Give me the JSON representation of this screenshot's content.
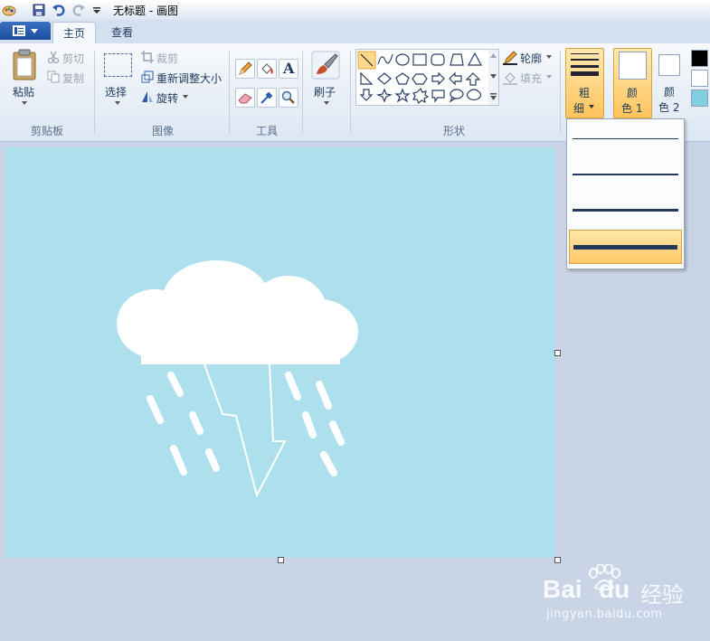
{
  "titlebar": {
    "title": "无标题 - 画图",
    "quick_access": [
      "paint-app-icon",
      "save-icon",
      "undo-icon",
      "redo-icon",
      "customize-arrow-icon"
    ]
  },
  "tabs": {
    "home": "主页",
    "view": "查看"
  },
  "clipboard": {
    "paste": "粘贴",
    "cut": "剪切",
    "copy": "复制",
    "group": "剪贴板"
  },
  "image": {
    "select": "选择",
    "crop": "裁剪",
    "resize": "重新调整大小",
    "rotate": "旋转",
    "group": "图像"
  },
  "tools": {
    "group": "工具",
    "items": [
      "pencil-icon",
      "fill-bucket-icon",
      "text-icon",
      "eraser-icon",
      "color-picker-icon",
      "magnifier-icon"
    ],
    "text_glyph": "A"
  },
  "brushes": {
    "label": "刷子"
  },
  "shapes": {
    "group": "形状",
    "outline": "轮廓",
    "fill": "填充"
  },
  "size": {
    "label_line1": "粗",
    "label_line2": "细"
  },
  "colors": {
    "color1_line1": "颜",
    "color1_line2": "色 1",
    "color2_line1": "颜",
    "color2_line2": "色 2",
    "color1_value": "#ffffff",
    "color2_value": "#ffffff",
    "palette": [
      "#000000",
      "#ffffff",
      "#7fcfe0"
    ]
  },
  "canvas": {
    "background": "#ade0ec",
    "elements": [
      "cloud",
      "rain-drops",
      "lightning-bolt"
    ]
  },
  "size_dropdown": {
    "options": [
      "1px",
      "3px",
      "5px",
      "8px"
    ],
    "selected_index": 3
  },
  "watermark": {
    "brand": "Bai",
    "brand2": "du",
    "product": "经验",
    "url": "jingyan.baidu.com"
  }
}
